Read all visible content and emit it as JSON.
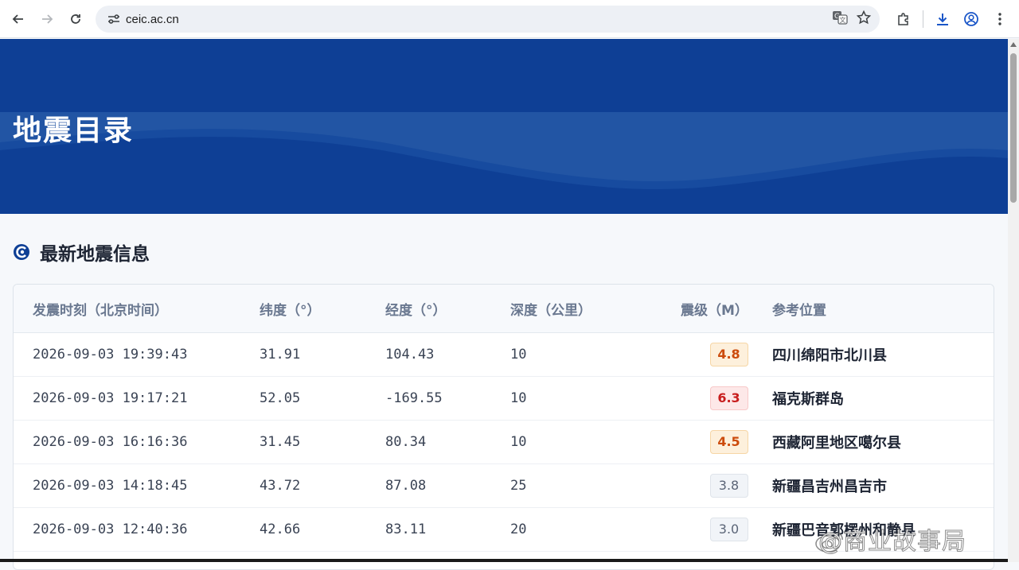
{
  "browser": {
    "url": "ceic.ac.cn"
  },
  "hero": {
    "title": "地震目录"
  },
  "section": {
    "title": "最新地震信息"
  },
  "table": {
    "headers": {
      "time": "发震时刻（北京时间）",
      "lat": "纬度（°）",
      "lon": "经度（°）",
      "depth": "深度（公里）",
      "mag": "震级（M）",
      "loc": "参考位置"
    },
    "rows": [
      {
        "time": "2026-09-03 19:39:43",
        "lat": "31.91",
        "lon": "104.43",
        "depth": "10",
        "mag": "4.8",
        "loc": "四川绵阳市北川县"
      },
      {
        "time": "2026-09-03 19:17:21",
        "lat": "52.05",
        "lon": "-169.55",
        "depth": "10",
        "mag": "6.3",
        "loc": "福克斯群岛"
      },
      {
        "time": "2026-09-03 16:16:36",
        "lat": "31.45",
        "lon": "80.34",
        "depth": "10",
        "mag": "4.5",
        "loc": "西藏阿里地区噶尔县"
      },
      {
        "time": "2026-09-03 14:18:45",
        "lat": "43.72",
        "lon": "87.08",
        "depth": "25",
        "mag": "3.8",
        "loc": "新疆昌吉州昌吉市"
      },
      {
        "time": "2026-09-03 12:40:36",
        "lat": "42.66",
        "lon": "83.11",
        "depth": "20",
        "mag": "3.0",
        "loc": "新疆巴音郭楞州和静县"
      }
    ]
  },
  "colors": {
    "hero_bg": "#0e3f95",
    "mag_high": "#c81e1e",
    "mag_mid": "#cc4b0c",
    "mag_low": "#5b6577"
  },
  "watermark": {
    "text": "@商业故事局"
  }
}
